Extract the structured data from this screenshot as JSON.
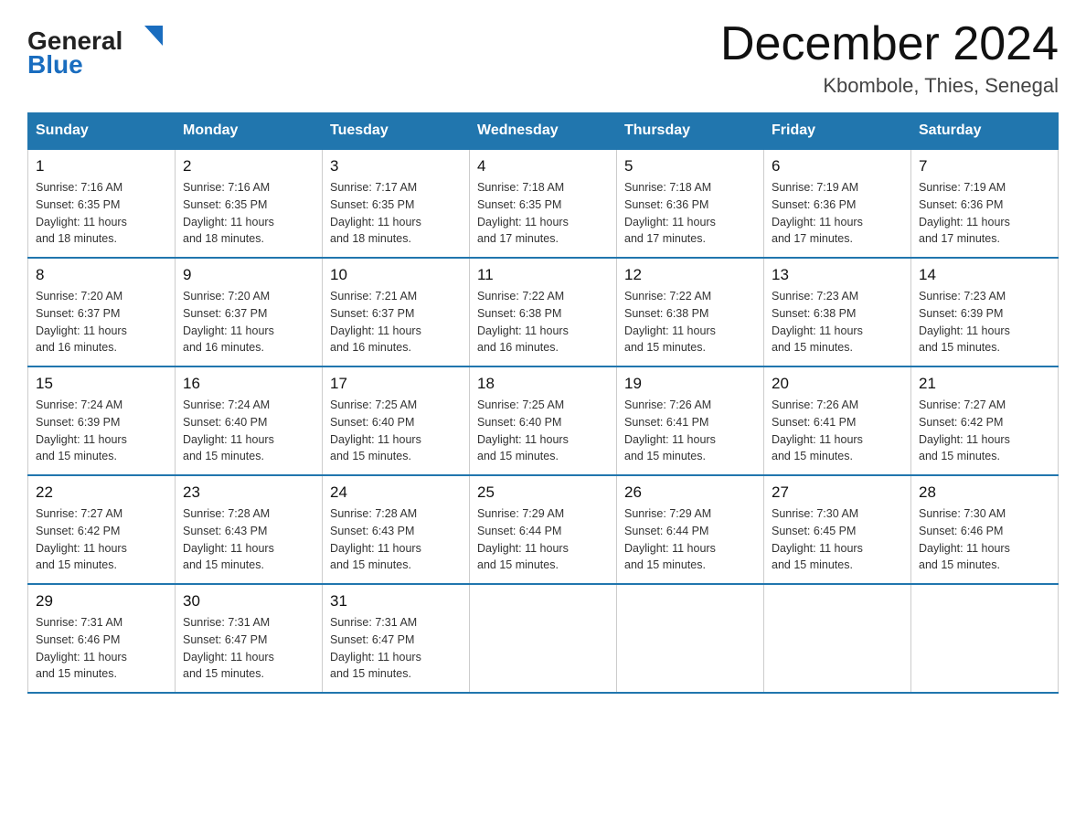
{
  "header": {
    "title": "December 2024",
    "subtitle": "Kbombole, Thies, Senegal",
    "logo_general": "General",
    "logo_blue": "Blue"
  },
  "columns": [
    "Sunday",
    "Monday",
    "Tuesday",
    "Wednesday",
    "Thursday",
    "Friday",
    "Saturday"
  ],
  "weeks": [
    [
      {
        "day": "1",
        "sunrise": "7:16 AM",
        "sunset": "6:35 PM",
        "daylight": "11 hours and 18 minutes."
      },
      {
        "day": "2",
        "sunrise": "7:16 AM",
        "sunset": "6:35 PM",
        "daylight": "11 hours and 18 minutes."
      },
      {
        "day": "3",
        "sunrise": "7:17 AM",
        "sunset": "6:35 PM",
        "daylight": "11 hours and 18 minutes."
      },
      {
        "day": "4",
        "sunrise": "7:18 AM",
        "sunset": "6:35 PM",
        "daylight": "11 hours and 17 minutes."
      },
      {
        "day": "5",
        "sunrise": "7:18 AM",
        "sunset": "6:36 PM",
        "daylight": "11 hours and 17 minutes."
      },
      {
        "day": "6",
        "sunrise": "7:19 AM",
        "sunset": "6:36 PM",
        "daylight": "11 hours and 17 minutes."
      },
      {
        "day": "7",
        "sunrise": "7:19 AM",
        "sunset": "6:36 PM",
        "daylight": "11 hours and 17 minutes."
      }
    ],
    [
      {
        "day": "8",
        "sunrise": "7:20 AM",
        "sunset": "6:37 PM",
        "daylight": "11 hours and 16 minutes."
      },
      {
        "day": "9",
        "sunrise": "7:20 AM",
        "sunset": "6:37 PM",
        "daylight": "11 hours and 16 minutes."
      },
      {
        "day": "10",
        "sunrise": "7:21 AM",
        "sunset": "6:37 PM",
        "daylight": "11 hours and 16 minutes."
      },
      {
        "day": "11",
        "sunrise": "7:22 AM",
        "sunset": "6:38 PM",
        "daylight": "11 hours and 16 minutes."
      },
      {
        "day": "12",
        "sunrise": "7:22 AM",
        "sunset": "6:38 PM",
        "daylight": "11 hours and 15 minutes."
      },
      {
        "day": "13",
        "sunrise": "7:23 AM",
        "sunset": "6:38 PM",
        "daylight": "11 hours and 15 minutes."
      },
      {
        "day": "14",
        "sunrise": "7:23 AM",
        "sunset": "6:39 PM",
        "daylight": "11 hours and 15 minutes."
      }
    ],
    [
      {
        "day": "15",
        "sunrise": "7:24 AM",
        "sunset": "6:39 PM",
        "daylight": "11 hours and 15 minutes."
      },
      {
        "day": "16",
        "sunrise": "7:24 AM",
        "sunset": "6:40 PM",
        "daylight": "11 hours and 15 minutes."
      },
      {
        "day": "17",
        "sunrise": "7:25 AM",
        "sunset": "6:40 PM",
        "daylight": "11 hours and 15 minutes."
      },
      {
        "day": "18",
        "sunrise": "7:25 AM",
        "sunset": "6:40 PM",
        "daylight": "11 hours and 15 minutes."
      },
      {
        "day": "19",
        "sunrise": "7:26 AM",
        "sunset": "6:41 PM",
        "daylight": "11 hours and 15 minutes."
      },
      {
        "day": "20",
        "sunrise": "7:26 AM",
        "sunset": "6:41 PM",
        "daylight": "11 hours and 15 minutes."
      },
      {
        "day": "21",
        "sunrise": "7:27 AM",
        "sunset": "6:42 PM",
        "daylight": "11 hours and 15 minutes."
      }
    ],
    [
      {
        "day": "22",
        "sunrise": "7:27 AM",
        "sunset": "6:42 PM",
        "daylight": "11 hours and 15 minutes."
      },
      {
        "day": "23",
        "sunrise": "7:28 AM",
        "sunset": "6:43 PM",
        "daylight": "11 hours and 15 minutes."
      },
      {
        "day": "24",
        "sunrise": "7:28 AM",
        "sunset": "6:43 PM",
        "daylight": "11 hours and 15 minutes."
      },
      {
        "day": "25",
        "sunrise": "7:29 AM",
        "sunset": "6:44 PM",
        "daylight": "11 hours and 15 minutes."
      },
      {
        "day": "26",
        "sunrise": "7:29 AM",
        "sunset": "6:44 PM",
        "daylight": "11 hours and 15 minutes."
      },
      {
        "day": "27",
        "sunrise": "7:30 AM",
        "sunset": "6:45 PM",
        "daylight": "11 hours and 15 minutes."
      },
      {
        "day": "28",
        "sunrise": "7:30 AM",
        "sunset": "6:46 PM",
        "daylight": "11 hours and 15 minutes."
      }
    ],
    [
      {
        "day": "29",
        "sunrise": "7:31 AM",
        "sunset": "6:46 PM",
        "daylight": "11 hours and 15 minutes."
      },
      {
        "day": "30",
        "sunrise": "7:31 AM",
        "sunset": "6:47 PM",
        "daylight": "11 hours and 15 minutes."
      },
      {
        "day": "31",
        "sunrise": "7:31 AM",
        "sunset": "6:47 PM",
        "daylight": "11 hours and 15 minutes."
      },
      null,
      null,
      null,
      null
    ]
  ],
  "labels": {
    "sunrise": "Sunrise:",
    "sunset": "Sunset:",
    "daylight": "Daylight:"
  }
}
